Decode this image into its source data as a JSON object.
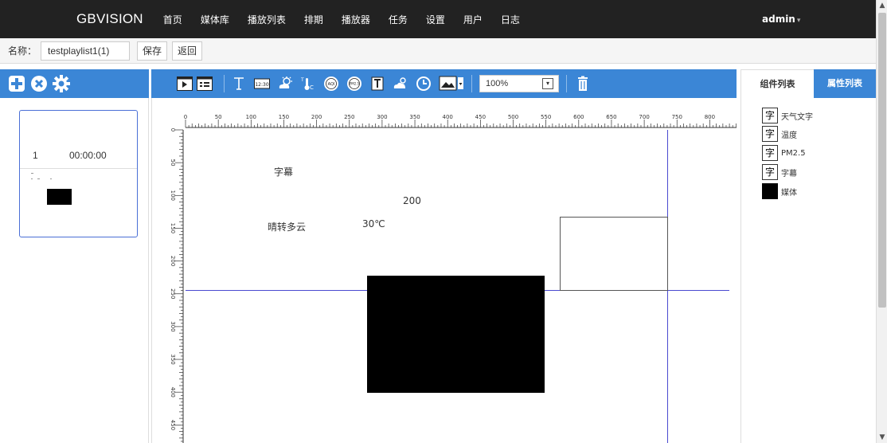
{
  "navbar": {
    "brand": "GBVISION",
    "items": [
      "首页",
      "媒体库",
      "播放列表",
      "排期",
      "播放器",
      "任务",
      "设置",
      "用户",
      "日志"
    ],
    "user": "admin"
  },
  "subbar": {
    "name_label": "名称：",
    "name_value": "testplaylist1(1)",
    "save_label": "保存",
    "back_label": "返回"
  },
  "playlist": {
    "items": [
      {
        "index": "1",
        "duration": "00:00:00"
      }
    ]
  },
  "toolbar": {
    "icons": [
      "play-preview-icon",
      "list-view-icon",
      "text-icon",
      "clock-digital-icon",
      "weather-icon",
      "temperature-icon",
      "aqi-icon",
      "pm25-icon",
      "document-icon",
      "cloud-sun-icon",
      "clock-icon",
      "image-dropdown-icon",
      "trash-icon"
    ],
    "zoom": "100%"
  },
  "ruler": {
    "x_labels": [
      "0",
      "50",
      "100",
      "150",
      "200",
      "250",
      "300",
      "350",
      "400",
      "450",
      "500",
      "550",
      "600",
      "650",
      "700",
      "750",
      "800"
    ],
    "y_labels": [
      "0",
      "50",
      "100",
      "150",
      "200",
      "250",
      "300",
      "350",
      "400",
      "450"
    ]
  },
  "canvas": {
    "texts": {
      "subtitle": "字幕",
      "pm_value": "200",
      "temperature": "30℃",
      "weather": "晴转多云"
    }
  },
  "right_panel": {
    "tab_components": "组件列表",
    "tab_properties": "属性列表",
    "components": [
      {
        "icon": "字",
        "label": "天气文字"
      },
      {
        "icon": "字",
        "label": "温度"
      },
      {
        "icon": "字",
        "label": "PM2.5"
      },
      {
        "icon": "字",
        "label": "字幕"
      },
      {
        "icon": "",
        "label": "媒体"
      }
    ]
  }
}
